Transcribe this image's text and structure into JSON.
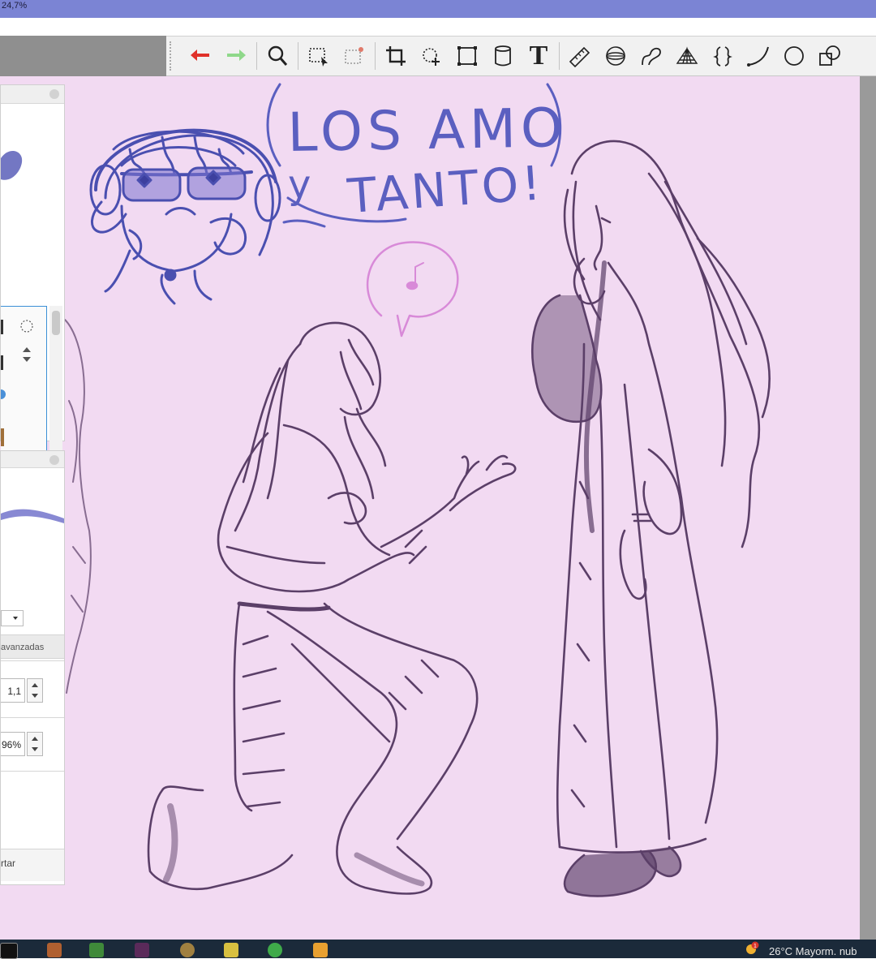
{
  "window": {
    "zoom_label": "24,7%"
  },
  "toolbar": {
    "tools": [
      {
        "name": "undo-icon",
        "label": "Deshacer"
      },
      {
        "name": "redo-icon",
        "label": "Rehacer"
      },
      {
        "name": "zoom-icon",
        "label": "Zoom"
      },
      {
        "name": "select-rect-icon",
        "label": "Selección"
      },
      {
        "name": "select-magic-icon",
        "label": "Selección mágica"
      },
      {
        "name": "crop-icon",
        "label": "Recortar"
      },
      {
        "name": "move-icon",
        "label": "Mover"
      },
      {
        "name": "transform-icon",
        "label": "Transformar"
      },
      {
        "name": "bucket-icon",
        "label": "Relleno"
      },
      {
        "name": "text-icon",
        "label": "Texto"
      },
      {
        "name": "ruler-icon",
        "label": "Regla"
      },
      {
        "name": "ellipse-ruler-icon",
        "label": "Regla elipse"
      },
      {
        "name": "curve-icon",
        "label": "Curva"
      },
      {
        "name": "perspective-icon",
        "label": "Perspectiva"
      },
      {
        "name": "symmetry-icon",
        "label": "Simetría"
      },
      {
        "name": "arc-icon",
        "label": "Arco"
      },
      {
        "name": "circle-icon",
        "label": "Círculo"
      },
      {
        "name": "shape-icon",
        "label": "Formas"
      }
    ],
    "text_tool_glyph": "T"
  },
  "panels": {
    "stroke": {
      "advanced_label": "avanzadas",
      "field1_value": "1,1",
      "field2_value": "96%",
      "cut_label": "rtar"
    }
  },
  "artwork": {
    "speech_line1": "LOS AMO",
    "speech_line2": "TANTO!",
    "speech_line3": "y",
    "colors": {
      "canvas": "#f2daf2",
      "ink_blue": "#4a4fb0",
      "ink_purple": "#5b3f68",
      "bubble_pink": "#d88ad8"
    }
  },
  "taskbar": {
    "weather": "26°C  Mayorm. nub",
    "notification_count": "1"
  }
}
